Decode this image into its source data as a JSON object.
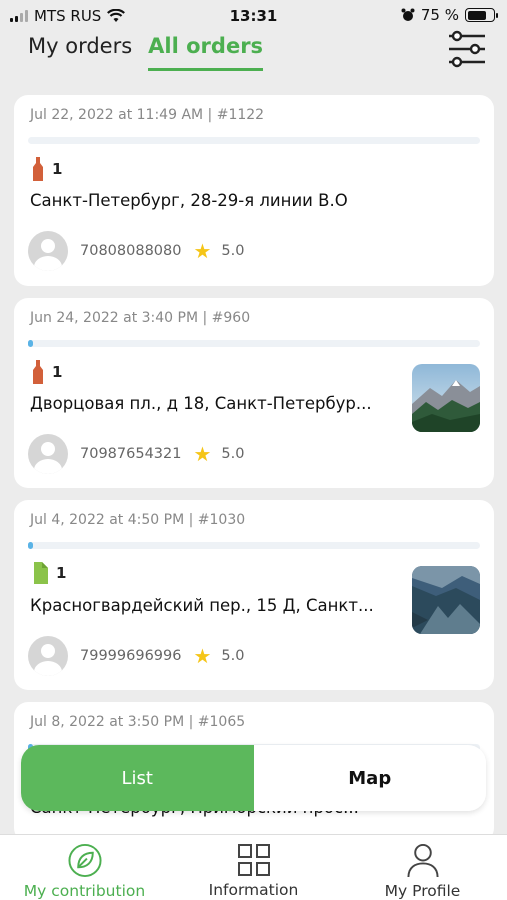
{
  "status_bar": {
    "carrier": "MTS RUS",
    "time": "13:31",
    "battery": "75 %",
    "battery_level": 0.75
  },
  "header": {
    "tabs": [
      {
        "label": "My orders",
        "active": false
      },
      {
        "label": "All orders",
        "active": true
      }
    ]
  },
  "orders": [
    {
      "meta": "Jul 22, 2022 at 11:49 AM | #1122",
      "progress": 0,
      "item_icon": "bottle-icon",
      "item_color": "#d2603a",
      "qty": "1",
      "address": "Санкт-Петербург, 28-29-я линии В.О",
      "phone": "70808088080",
      "rating": "5.0",
      "thumb": null
    },
    {
      "meta": "Jun 24, 2022 at 3:40 PM | #960",
      "progress": 0.01,
      "item_icon": "bottle-icon",
      "item_color": "#d2603a",
      "qty": "1",
      "address": "Дворцовая пл., д 18, Санкт-Петербур...",
      "phone": "70987654321",
      "rating": "5.0",
      "thumb": "mountain-photo"
    },
    {
      "meta": "Jul 4, 2022 at 4:50 PM | #1030",
      "progress": 0.01,
      "item_icon": "package-icon",
      "item_color": "#8bc34a",
      "qty": "1",
      "address": "Красногвардейский пер., 15 Д, Санкт...",
      "phone": "79999696996",
      "rating": "5.0",
      "thumb": "valley-photo"
    },
    {
      "meta": "Jul 8, 2022 at 3:50 PM | #1065",
      "progress": 0.01,
      "item_icon": "bottle-icon",
      "item_color": "#d2603a",
      "qty": "",
      "address": "Санкт-Петербург, Приморский прос...",
      "phone": "",
      "rating": "",
      "thumb": null
    }
  ],
  "view_toggle": {
    "list_label": "List",
    "map_label": "Map",
    "active": "List"
  },
  "bottom_nav": [
    {
      "label": "My contribution",
      "icon": "leaf-icon",
      "active": true
    },
    {
      "label": "Information",
      "icon": "grid-icon",
      "active": false
    },
    {
      "label": "My Profile",
      "icon": "person-icon",
      "active": false
    }
  ],
  "colors": {
    "accent": "#4caf50",
    "toggle_green": "#5cb85c",
    "progress": "#5ab3e6",
    "star": "#f5c518"
  }
}
